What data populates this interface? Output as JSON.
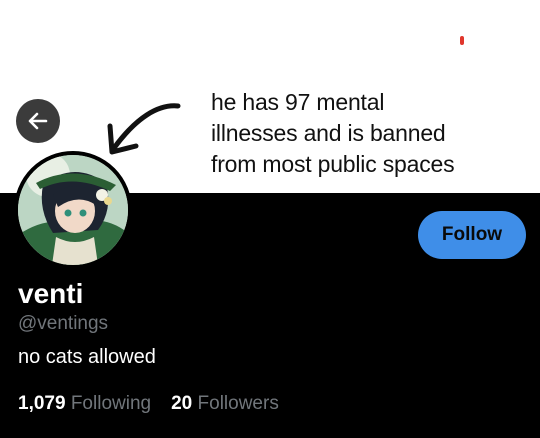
{
  "banner": {
    "caption_lines": [
      "he has 97 mental",
      "illnesses and is banned",
      "from most public spaces"
    ]
  },
  "icons": {
    "back": "arrow-left-icon",
    "doodle": "hand-drawn-arrow"
  },
  "profile": {
    "display_name": "venti",
    "handle": "@ventings",
    "bio": "no cats allowed",
    "follow_label": "Follow",
    "following_count": "1,079",
    "following_label": "Following",
    "followers_count": "20",
    "followers_label": "Followers"
  },
  "colors": {
    "background": "#000000",
    "follow_button": "#3f8ee8",
    "muted_text": "#71767b"
  }
}
